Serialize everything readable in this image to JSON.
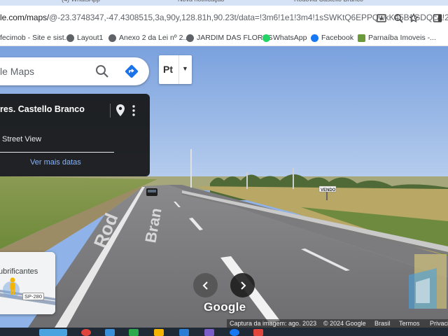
{
  "browser": {
    "tabs": [
      "(4) WhatsApp",
      "Nova notificação",
      "Rodovia Castello Branco"
    ],
    "url_host": "le.com/maps/",
    "url_path": "@-23.3748347,-47.4308515,3a,90y,128.81h,90.23t/data=!3m6!1e1!3m4!1sSWKtQ6EPPQwkK45B1GDQcA!2...",
    "icons": [
      "install-icon",
      "zoom-icon",
      "star-icon",
      "sidebar-icon"
    ]
  },
  "bookmarks": [
    {
      "label": "fecimob - Site e sist...",
      "color": "#e0803a"
    },
    {
      "label": "Layout1",
      "color": "#5f6368"
    },
    {
      "label": "Anexo 2 da Lei nº 2...",
      "color": "#5f6368"
    },
    {
      "label": "JARDIM DAS FLORES",
      "color": "#5f6368"
    },
    {
      "label": "WhatsApp",
      "color": "#25d366"
    },
    {
      "label": "Facebook",
      "color": "#1877f2"
    },
    {
      "label": "Parnaíba Imoveis -...",
      "color": "#6a9a3a"
    }
  ],
  "search": {
    "text": "le Maps"
  },
  "lang_button": {
    "label": "Pt"
  },
  "card": {
    "title": "res. Castello Branco",
    "street_view": "Street View",
    "more_dates": "Ver mais datas"
  },
  "minimap": {
    "label": "ubrificantes",
    "road_shield": "SP-280"
  },
  "road_sign": "VENDO",
  "road_text": [
    "Rod",
    "Bran"
  ],
  "google_logo": "Google",
  "footer": {
    "capture": "Captura da imagem: ago. 2023",
    "copyright": "© 2024 Google",
    "country": "Brasil",
    "terms": "Termos",
    "privacy": "Privacidade"
  }
}
